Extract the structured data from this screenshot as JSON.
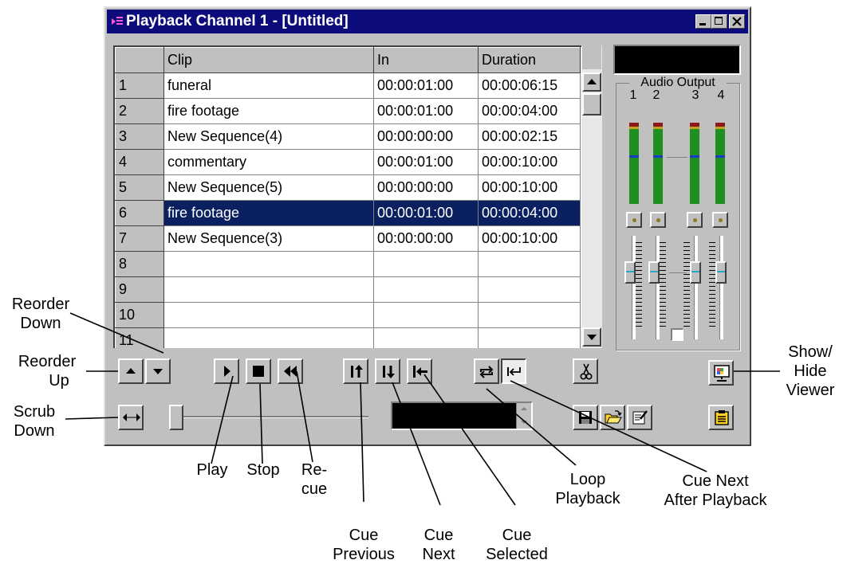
{
  "window": {
    "title": "Playback Channel 1 - [Untitled]",
    "minimize_icon": "minimize-icon",
    "maximize_icon": "maximize-icon",
    "close_icon": "close-icon"
  },
  "clip_table": {
    "columns": [
      "",
      "Clip",
      "In",
      "Duration"
    ],
    "rows": [
      {
        "num": "1",
        "clip": "funeral",
        "in": "00:00:01:00",
        "duration": "00:00:06:15"
      },
      {
        "num": "2",
        "clip": "fire footage",
        "in": "00:00:01:00",
        "duration": "00:00:04:00"
      },
      {
        "num": "3",
        "clip": "New Sequence(4)",
        "in": "00:00:00:00",
        "duration": "00:00:02:15"
      },
      {
        "num": "4",
        "clip": "commentary",
        "in": "00:00:01:00",
        "duration": "00:00:10:00"
      },
      {
        "num": "5",
        "clip": "New Sequence(5)",
        "in": "00:00:00:00",
        "duration": "00:00:10:00"
      },
      {
        "num": "6",
        "clip": "fire footage",
        "in": "00:00:01:00",
        "duration": "00:00:04:00",
        "selected": true
      },
      {
        "num": "7",
        "clip": "New Sequence(3)",
        "in": "00:00:00:00",
        "duration": "00:00:10:00"
      },
      {
        "num": "8",
        "clip": "",
        "in": "",
        "duration": ""
      },
      {
        "num": "9",
        "clip": "",
        "in": "",
        "duration": ""
      },
      {
        "num": "10",
        "clip": "",
        "in": "",
        "duration": ""
      },
      {
        "num": "11",
        "clip": "",
        "in": "",
        "duration": ""
      }
    ]
  },
  "audio_output": {
    "title": "Audio Output",
    "channels": [
      "1",
      "2",
      "3",
      "4"
    ]
  },
  "callouts": {
    "reorder_down": [
      "Reorder",
      "Down"
    ],
    "reorder_up": [
      "Reorder",
      "Up"
    ],
    "scrub_down": [
      "Scrub",
      "Down"
    ],
    "play": "Play",
    "stop": "Stop",
    "recue": [
      "Re-",
      "cue"
    ],
    "cue_previous": [
      "Cue",
      "Previous"
    ],
    "cue_next": [
      "Cue",
      "Next"
    ],
    "cue_selected": [
      "Cue",
      "Selected"
    ],
    "loop_playback": [
      "Loop",
      "Playback"
    ],
    "cue_next_after": [
      "Cue Next",
      "After Playback"
    ],
    "show_hide_viewer": [
      "Show/",
      "Hide",
      "Viewer"
    ]
  },
  "colors": {
    "title_bar": "#0b0b7c",
    "selection": "#0b2060",
    "meter_green": "#1f8f1f",
    "meter_marker": "#1a3acc"
  }
}
